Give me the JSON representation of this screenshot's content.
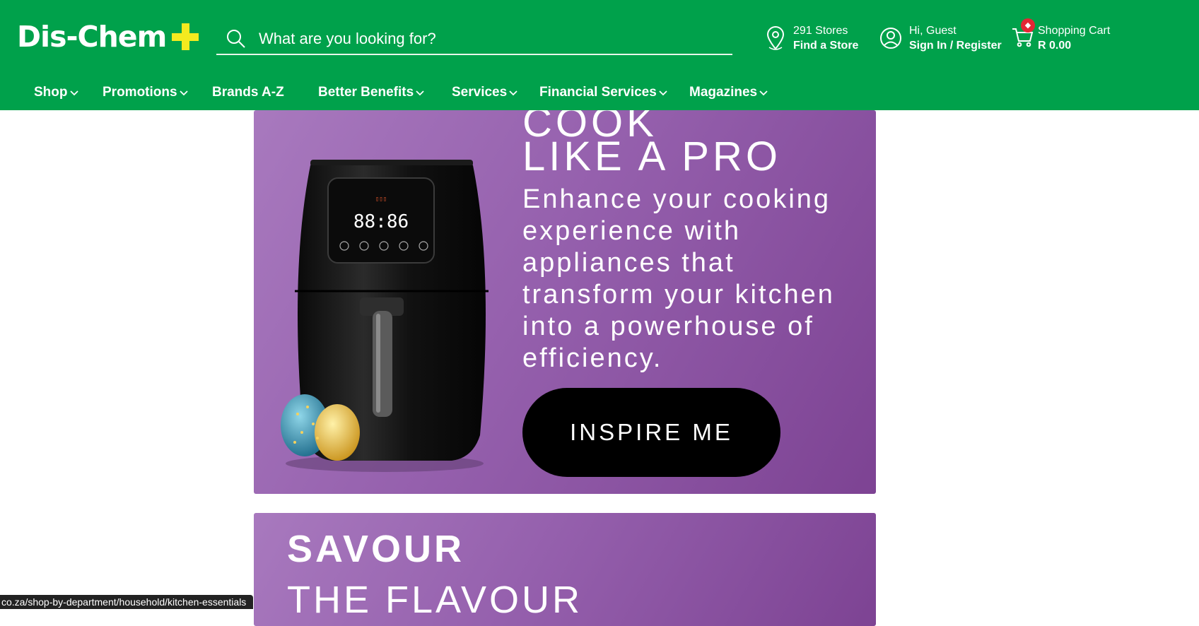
{
  "header": {
    "logo_text": "Dis-Chem",
    "search_placeholder": "What are you looking for?",
    "stores_count": "291 Stores",
    "find_store": "Find a Store",
    "greeting": "Hi, Guest",
    "sign_in": "Sign In / Register",
    "cart_label": "Shopping Cart",
    "cart_total": "R 0.00"
  },
  "nav": {
    "items": [
      "Shop",
      "Promotions",
      "Brands A-Z",
      "Better Benefits",
      "Services",
      "Financial Services",
      "Magazines"
    ]
  },
  "banner1": {
    "word1": "COOK",
    "title": "LIKE A PRO",
    "lines": [
      "Enhance your cooking",
      "experience with",
      "appliances that",
      "transform your kitchen",
      "into a powerhouse of",
      "efficiency."
    ],
    "button": "INSPIRE ME",
    "display_time": "88:86"
  },
  "banner2": {
    "word1": "SAVOUR",
    "word2": "THE FLAVOUR"
  },
  "status_url": "co.za/shop-by-department/household/kitchen-essentials",
  "colors": {
    "brand_green": "#00a14b",
    "logo_plus": "#f4ea1f",
    "banner_purple": "#9560ad",
    "badge_red": "#e32634"
  }
}
